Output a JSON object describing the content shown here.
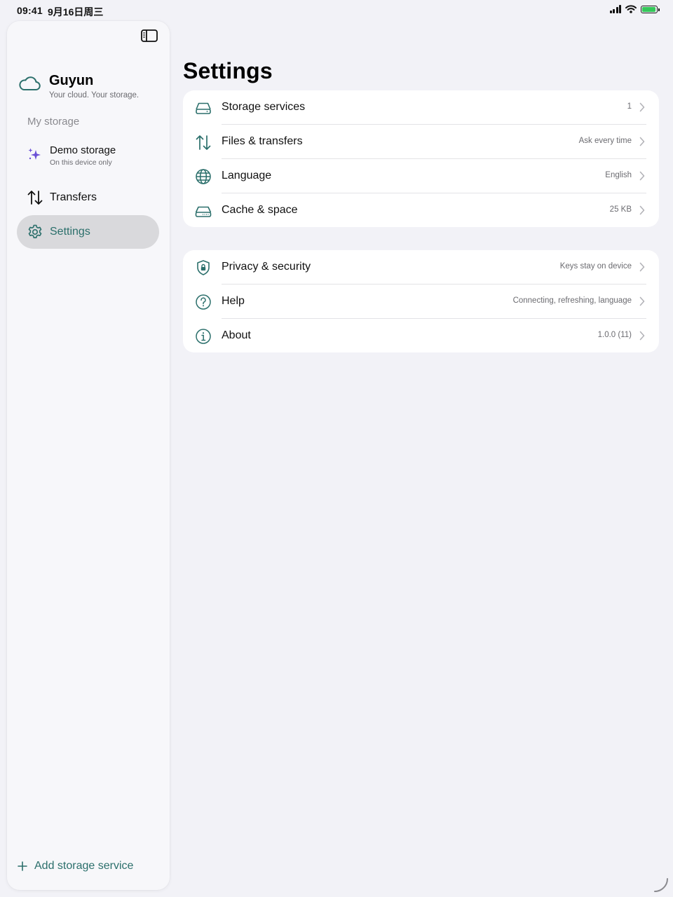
{
  "status_bar": {
    "time": "09:41",
    "date": "9月16日周三"
  },
  "sidebar": {
    "app_name": "Guyun",
    "tagline": "Your cloud. Your storage.",
    "section_label": "My storage",
    "storage_item": {
      "name": "Demo storage",
      "subtitle": "On this device only",
      "icon": "sparkles-icon"
    },
    "nav": [
      {
        "label": "Transfers",
        "icon": "arrows-up-down-icon",
        "selected": false
      },
      {
        "label": "Settings",
        "icon": "gear-icon",
        "selected": true
      }
    ],
    "add_button_label": "Add storage service"
  },
  "main": {
    "title": "Settings",
    "groups": [
      {
        "rows": [
          {
            "label": "Storage services",
            "value": "1",
            "icon": "drive-icon"
          },
          {
            "label": "Files & transfers",
            "value": "Ask every time",
            "icon": "arrows-up-down-icon"
          },
          {
            "label": "Language",
            "value": "English",
            "icon": "globe-icon"
          },
          {
            "label": "Cache & space",
            "value": "25 KB",
            "icon": "disk-icon"
          }
        ]
      },
      {
        "rows": [
          {
            "label": "Privacy & security",
            "value": "Keys stay on device",
            "icon": "shield-lock-icon"
          },
          {
            "label": "Help",
            "value": "Connecting, refreshing, language",
            "icon": "question-circle-icon"
          },
          {
            "label": "About",
            "value": "1.0.0 (11)",
            "icon": "info-circle-icon"
          }
        ]
      }
    ]
  },
  "colors": {
    "accent": "#2b6f6b",
    "background": "#f2f2f7",
    "card": "#ffffff",
    "selected_fill": "#d9d9dc",
    "sparkle": "#6a4fd6"
  }
}
